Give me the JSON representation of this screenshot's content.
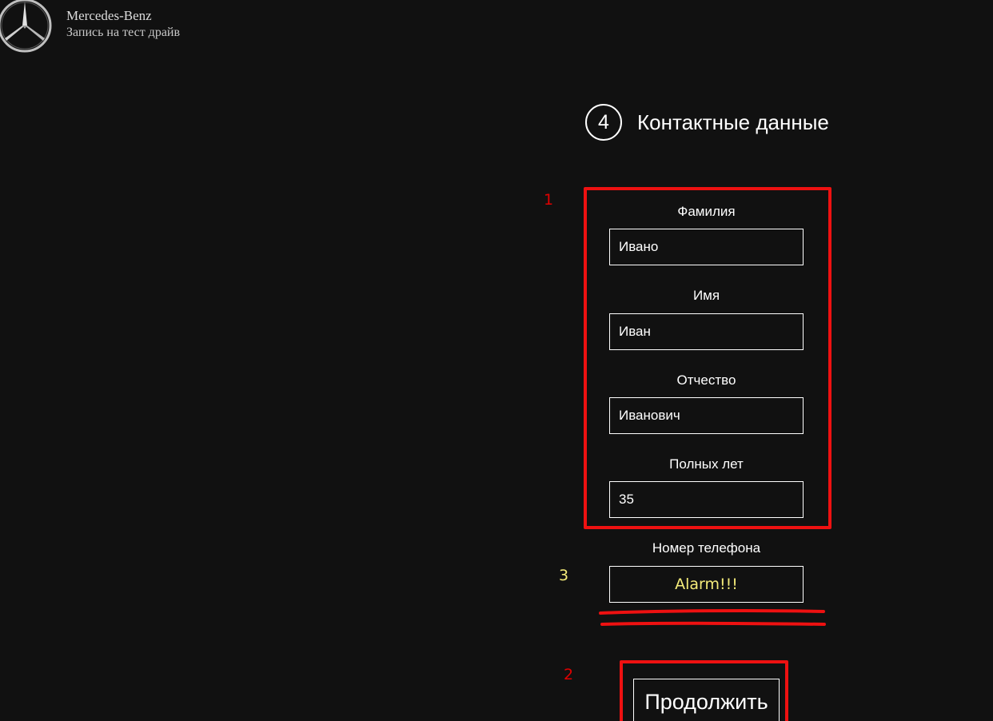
{
  "brand": {
    "name": "Mercedes-Benz",
    "subtitle": "Запись на тест драйв"
  },
  "step": {
    "number": "4",
    "title": "Контактные данные"
  },
  "form": {
    "fields": [
      {
        "label": "Фамилия",
        "value": "Ивано"
      },
      {
        "label": "Имя",
        "value": "Иван"
      },
      {
        "label": "Отчество",
        "value": "Иванович"
      },
      {
        "label": "Полных лет",
        "value": "35"
      },
      {
        "label": "Номер телефона",
        "value": "Alarm!!!"
      }
    ],
    "continue_label": "Продолжить"
  },
  "annotations": {
    "labels": [
      "1",
      "2",
      "3"
    ],
    "colors": {
      "box": "#ee1111",
      "label_red": "#e00000",
      "label_yellow": "#f5ec7a"
    }
  }
}
